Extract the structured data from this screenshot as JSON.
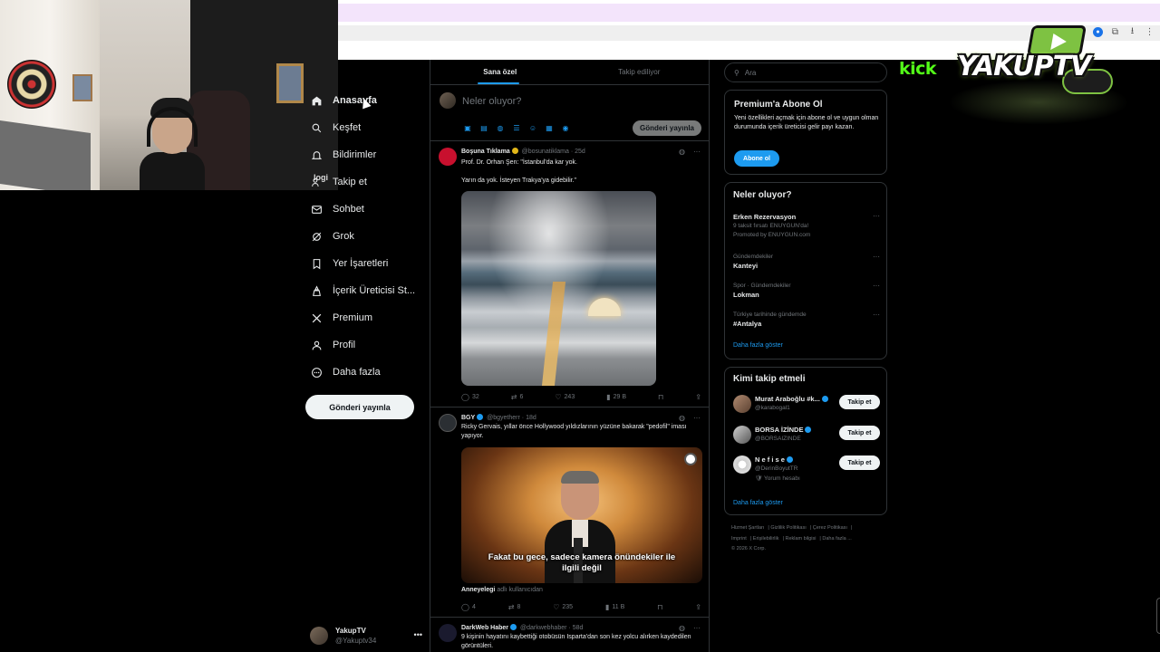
{
  "colors": {
    "background": "#000000",
    "accent": "#1d9bf0",
    "text": "#e7e9ea",
    "muted": "#71767b",
    "border": "#2f3336",
    "kick_green": "#53fc18"
  },
  "overlay": {
    "webcam_label": "logi",
    "kick_label": "kick",
    "channel_label": "YAKUPTV"
  },
  "nav": {
    "items": [
      {
        "label": "Anasayfa",
        "icon": "home-icon"
      },
      {
        "label": "Keşfet",
        "icon": "search-icon"
      },
      {
        "label": "Bildirimler",
        "icon": "bell-icon"
      },
      {
        "label": "Takip et",
        "icon": "people-icon"
      },
      {
        "label": "Sohbet",
        "icon": "mail-icon"
      },
      {
        "label": "Grok",
        "icon": "grok-icon"
      },
      {
        "label": "Yer İşaretleri",
        "icon": "bookmark-icon"
      },
      {
        "label": "İçerik Üreticisi St...",
        "icon": "creator-icon"
      },
      {
        "label": "Premium",
        "icon": "x-logo-icon"
      },
      {
        "label": "Profil",
        "icon": "person-icon"
      },
      {
        "label": "Daha fazla",
        "icon": "more-circle-icon"
      }
    ],
    "post_button": "Gönderi yayınla"
  },
  "account": {
    "name": "YakupTV",
    "handle": "@Yakuptv34"
  },
  "timeline": {
    "tabs": [
      "Sana özel",
      "Takip ediliyor"
    ],
    "active_tab": "Sana özel",
    "composer": {
      "placeholder": "Neler oluyor?",
      "post_button": "Gönderi yayınla"
    },
    "tweets": [
      {
        "name": "Boşuna Tıklama",
        "handle": "@bosunatiklama",
        "age": "25d",
        "text_line1": "Prof. Dr. Orhan Şen: \"İstanbul'da kar yok.",
        "text_line2": "Yarın da yok. İsteyen Trakya'ya gidebilir.\"",
        "replies": "32",
        "reposts": "6",
        "likes": "243",
        "views": "29 B"
      },
      {
        "name": "BGY",
        "handle": "@bgyetherr",
        "age": "18d",
        "text": "Ricky Gervais, yıllar önce Hollywood yıldızlarının yüzüne bakarak \"pedofil\" iması yapıyor.",
        "video_caption_line1": "Fakat bu gece, sadece kamera önündekiler ile",
        "video_caption_line2": "ilgili değil",
        "community_name": "Anneyelegi",
        "community_suffix": "adlı kullanıcıdan",
        "replies": "4",
        "reposts": "8",
        "likes": "235",
        "views": "11 B"
      },
      {
        "name": "DarkWeb Haber",
        "handle": "@darkwebhaber",
        "age": "58d",
        "text": "9 kişinin hayatını kaybettiği otobüsün Isparta'dan son kez yolcu alırken kaydedilen görüntüleri."
      }
    ]
  },
  "sidebar": {
    "search_placeholder": "Ara",
    "premium": {
      "title": "Premium'a Abone Ol",
      "description": "Yeni özellikleri açmak için abone ol ve uygun olman durumunda içerik üreticisi gelir payı kazan.",
      "button": "Abone ol"
    },
    "trends": {
      "title": "Neler oluyor?",
      "items": [
        {
          "context": "",
          "name": "Erken Rezervasyon",
          "sub": "9 taksit fırsatı ENUYGUN'da!",
          "promo": "Promoted by ENUYGUN.com"
        },
        {
          "context": "Gündemdekiler",
          "name": "Kanteyi",
          "sub": "",
          "promo": ""
        },
        {
          "context": "Spor · Gündemdekiler",
          "name": "Lokman",
          "sub": "",
          "promo": ""
        },
        {
          "context": "Türkiye tarihinde gündemde",
          "name": "#Antalya",
          "sub": "",
          "promo": ""
        }
      ],
      "show_more": "Daha fazla göster"
    },
    "who_to_follow": {
      "title": "Kimi takip etmeli",
      "items": [
        {
          "name": "Murat Araboğlu #k...",
          "handle": "@karabogal1",
          "extra": "",
          "button": "Takip et"
        },
        {
          "name": "BORSA İZİNDE",
          "handle": "@BORSAIZINDE",
          "extra": "",
          "button": "Takip et"
        },
        {
          "name": "N e f i s e",
          "handle": "@DerinBoyutTR",
          "extra": "Yorum hesabı",
          "button": "Takip et"
        }
      ],
      "show_more": "Daha fazla göster"
    },
    "footer": {
      "links": [
        "Hizmet Şartları",
        "Gizlilik Politikası",
        "Çerez Politikası",
        "Imprint",
        "Erişilebilirlik",
        "Reklam bilgisi",
        "Daha fazla ..."
      ],
      "copyright": "© 2026 X Corp."
    }
  }
}
